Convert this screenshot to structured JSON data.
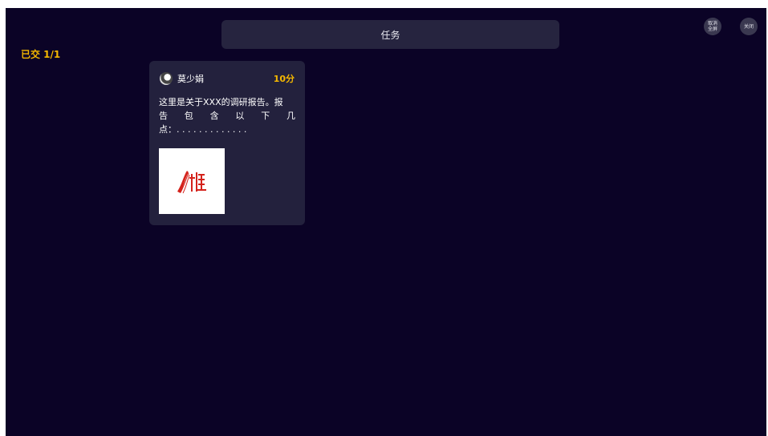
{
  "header": {
    "title": "任务",
    "exit_fullscreen_label": "取消全屏",
    "close_label": "关闭"
  },
  "status": {
    "submitted_label": "已交 1/1"
  },
  "submissions": [
    {
      "user_name": "莫少娟",
      "score": "10分",
      "content_line1": "这里是关于XXX的调研报告。报",
      "content_line2": [
        "告",
        "包",
        "含",
        "以",
        "下",
        "几"
      ],
      "content_line3": "点：. . . . . . . . . . . . .",
      "attachment_icon": "image-thumbnail"
    }
  ],
  "colors": {
    "background": "#0b0326",
    "panel": "#26243f",
    "card": "#23213d",
    "accent": "#f5b800"
  }
}
